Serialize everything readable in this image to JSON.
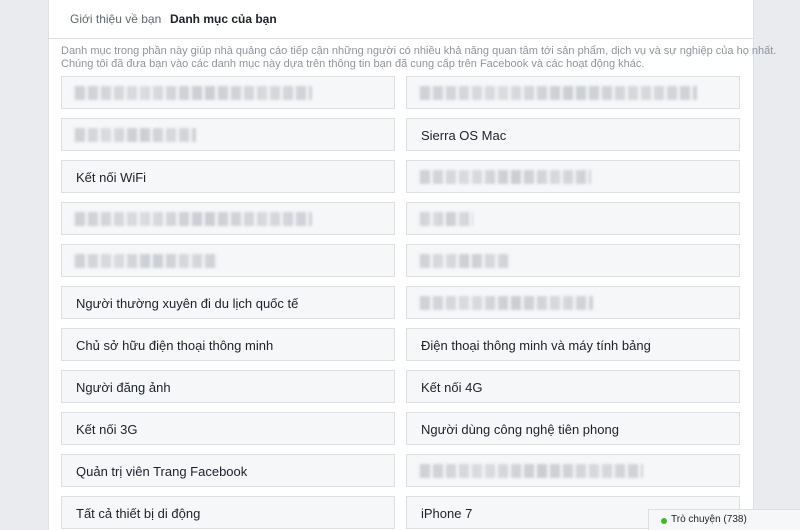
{
  "tabs": {
    "intro": "Giới thiệu về bạn",
    "categories": "Danh mục của bạn"
  },
  "description": {
    "line1": "Danh mục trong phần này giúp nhà quảng cáo tiếp cận những người có nhiều khả năng quan tâm tới sản phẩm, dịch vụ và sự nghiệp của họ nhất.",
    "line2": "Chúng tôi đã đưa bạn vào các danh mục này dựa trên thông tin bạn đã cung cấp trên Facebook và các hoạt động khác."
  },
  "categories": {
    "left": [
      "",
      "",
      "Kết nối WiFi",
      "",
      "",
      "Người thường xuyên đi du lịch quốc tế",
      "Chủ sở hữu điện thoại thông minh",
      "Người đăng ảnh",
      "Kết nối 3G",
      "Quản trị viên Trang Facebook",
      "Tất cả thiết bị di động"
    ],
    "right": [
      "",
      "Sierra OS Mac",
      "",
      "",
      "",
      "",
      "Điện thoại thông minh và máy tính bảng",
      "Kết nối 4G",
      "Người dùng công nghệ tiên phong",
      "",
      "iPhone 7"
    ]
  },
  "chat": {
    "label": "Trò chuyện (738)",
    "status_color": "#42b72a"
  }
}
